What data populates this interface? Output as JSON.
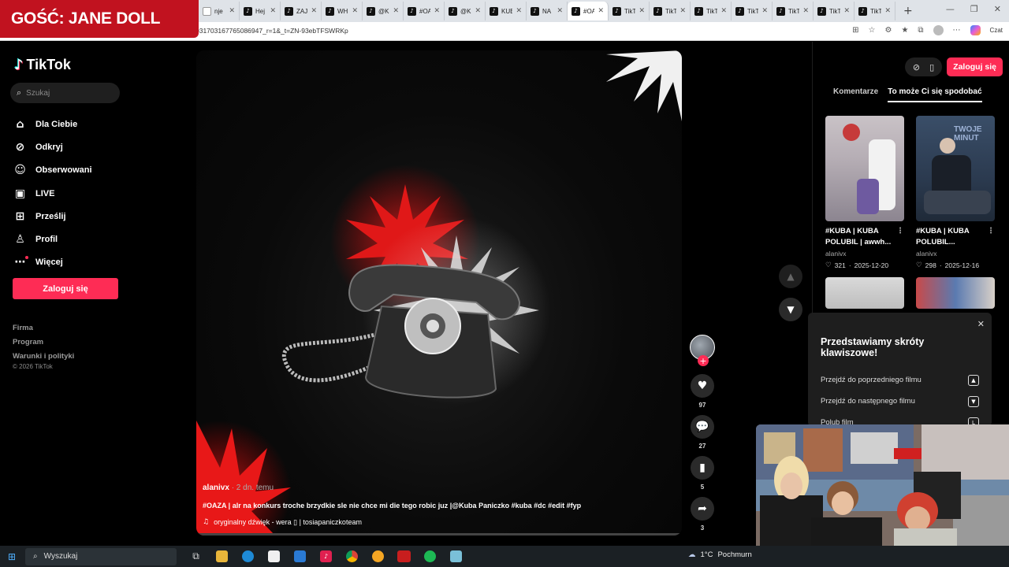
{
  "overlay": {
    "guest_banner": "GOŚĆ: JANE DOLL"
  },
  "browser": {
    "tabs": [
      {
        "label": "nje",
        "icon": "page-icon"
      },
      {
        "label": "Hej",
        "icon": "tiktok-icon"
      },
      {
        "label": "ZAJ",
        "icon": "tiktok-icon"
      },
      {
        "label": "WH",
        "icon": "tiktok-icon"
      },
      {
        "label": "@K",
        "icon": "tiktok-icon"
      },
      {
        "label": "#OA",
        "icon": "tiktok-icon"
      },
      {
        "label": "@K",
        "icon": "tiktok-icon"
      },
      {
        "label": "KUE",
        "icon": "tiktok-icon"
      },
      {
        "label": "NA",
        "icon": "tiktok-icon"
      },
      {
        "label": "#OA",
        "icon": "tiktok-icon"
      },
      {
        "label": "TikT",
        "icon": "tiktok-icon"
      },
      {
        "label": "TikT",
        "icon": "tiktok-icon"
      },
      {
        "label": "TikT",
        "icon": "tiktok-icon"
      },
      {
        "label": "TikT",
        "icon": "tiktok-icon"
      },
      {
        "label": "TikT",
        "icon": "tiktok-icon"
      },
      {
        "label": "TikT",
        "icon": "tiktok-icon"
      },
      {
        "label": "TikT",
        "icon": "tiktok-icon"
      }
    ],
    "url": "031703167765086947_r=1&_t=ZN-93ebTFSWRKp",
    "czat_label": "Czat"
  },
  "sidebar": {
    "logo_text": "TikTok",
    "search_placeholder": "Szukaj",
    "nav": [
      {
        "label": "Dla Ciebie",
        "icon": "home-icon"
      },
      {
        "label": "Odkryj",
        "icon": "compass-icon"
      },
      {
        "label": "Obserwowani",
        "icon": "following-icon"
      },
      {
        "label": "LIVE",
        "icon": "live-icon"
      },
      {
        "label": "Prześlij",
        "icon": "upload-icon"
      },
      {
        "label": "Profil",
        "icon": "profile-icon"
      },
      {
        "label": "Więcej",
        "icon": "more-icon"
      }
    ],
    "login_label": "Zaloguj się",
    "footer": [
      "Firma",
      "Program",
      "Warunki i polityki"
    ],
    "copyright": "© 2026 TikTok"
  },
  "video": {
    "author": "alanivx",
    "age": " · 2 dn. temu",
    "caption": "#OAZA | alr na konkurs troche brzydkie sle nie chce mi die tego robic juz |@Kuba Paniczko #kuba #dc #edit #fyp",
    "sound": "oryginalny dźwięk - wera ▯ | tosiapaniczkoteam"
  },
  "actions": {
    "likes": "97",
    "comments": "27",
    "saves": "5",
    "shares": "3"
  },
  "right_panel": {
    "login_label": "Zaloguj się",
    "tabs": [
      "Komentarze",
      "To może Ci się spodobać"
    ],
    "cards": [
      {
        "title": "#KUBA | KUBA POLUBIL | awwh...",
        "user": "alanivx",
        "likes": "321",
        "date": "2025-12-20"
      },
      {
        "title": "#KUBA | KUBA POLUBIL...",
        "user": "alanivx",
        "likes": "298",
        "date": "2025-12-16"
      }
    ],
    "thumb2_text": "TWOJE MINUT"
  },
  "shortcuts_popup": {
    "title": "Przedstawiamy skróty klawiszowe!",
    "rows": [
      {
        "label": "Przejdź do poprzedniego filmu",
        "key": "▲"
      },
      {
        "label": "Przejdź do następnego filmu",
        "key": "▼"
      },
      {
        "label": "Polub film",
        "key": "L"
      }
    ]
  },
  "taskbar": {
    "search_placeholder": "Wyszukaj",
    "weather": "1°C",
    "weather_desc": "Pochmurn"
  }
}
